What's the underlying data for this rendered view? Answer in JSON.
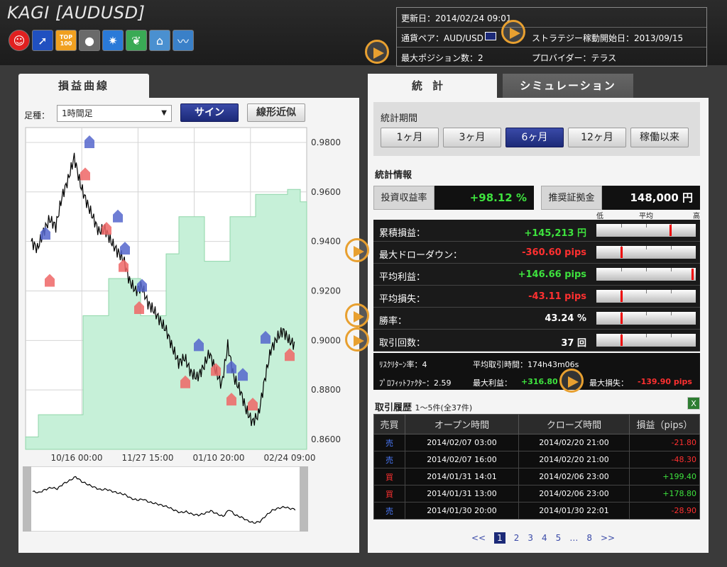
{
  "header": {
    "title": "KAGI [AUDUSD]",
    "icons": [
      "smiley-badge-icon",
      "rising-arrow-badge-icon",
      "top100-badge-icon",
      "sphere-badge-icon",
      "burst-badge-icon",
      "sprout-badge-icon",
      "house-badge-icon",
      "zigzag-chart-badge-icon"
    ],
    "top100_text": "TOP\n100"
  },
  "info": {
    "updated": "更新日：2014/02/24 09:01",
    "pair": "通貨ペア：AUD/USD",
    "start": "ストラテジー稼動開始日：2013/09/15",
    "max_pos": "最大ポジション数：2",
    "provider": "プロバイダー：テラス"
  },
  "left": {
    "tab": "損益曲線",
    "timeframe_label": "足種：",
    "timeframe_value": "1時間足",
    "sign_btn": "サイン",
    "linear_btn": "線形近似"
  },
  "chart_data": {
    "type": "line",
    "y_ticks": [
      "0.9800",
      "0.9600",
      "0.9400",
      "0.9200",
      "0.9000",
      "0.8800",
      "0.8600"
    ],
    "x_ticks": [
      "10/16 00:00",
      "11/27 15:00",
      "01/10 20:00",
      "02/24 09:00"
    ],
    "ylim": [
      0.856,
      0.986
    ],
    "series": [
      {
        "values": [
          0.94,
          0.937,
          0.944,
          0.949,
          0.946,
          0.958,
          0.965,
          0.974,
          0.963,
          0.956,
          0.95,
          0.944,
          0.945,
          0.94,
          0.936,
          0.933,
          0.924,
          0.92,
          0.922,
          0.915,
          0.912,
          0.908,
          0.904,
          0.897,
          0.891,
          0.893,
          0.887,
          0.885,
          0.889,
          0.895,
          0.888,
          0.882,
          0.898,
          0.885,
          0.88,
          0.872,
          0.867,
          0.87,
          0.884,
          0.896,
          0.901,
          0.904,
          0.9,
          0.898
        ]
      }
    ],
    "pl_steps": [
      0.861,
      0.861,
      0.87,
      0.87,
      0.87,
      0.87,
      0.87,
      0.87,
      0.87,
      0.91,
      0.91,
      0.91,
      0.91,
      0.925,
      0.925,
      0.925,
      0.925,
      0.925,
      0.91,
      0.91,
      0.91,
      0.91,
      0.935,
      0.935,
      0.95,
      0.95,
      0.95,
      0.95,
      0.932,
      0.932,
      0.932,
      0.932,
      0.95,
      0.95,
      0.95,
      0.95,
      0.959,
      0.959,
      0.959,
      0.959,
      0.959,
      0.961,
      0.961,
      0.956
    ]
  },
  "right": {
    "tab_stats": "統計",
    "tab_sim": "シミュレーション",
    "period_title": "統計期間",
    "periods": [
      "1ヶ月",
      "3ヶ月",
      "6ヶ月",
      "12ヶ月",
      "稼働以来"
    ],
    "stats_title": "統計情報",
    "roi_label": "投資収益率",
    "roi_value": "+98.12 %",
    "margin_label": "推奨証拠金",
    "margin_value": "148,000 円",
    "scale": {
      "low": "低",
      "mid": "平均",
      "high": "高"
    },
    "rows": [
      {
        "label": "累積損益：",
        "value": "+145,213 円",
        "color": "#3ee23e",
        "level": 0.75
      },
      {
        "label": "最大ドローダウン：",
        "value": "-360.60 pips",
        "color": "#ff3030",
        "level": 0.25
      },
      {
        "label": "平均利益：",
        "value": "+146.66 pips",
        "color": "#3ee23e",
        "level": 0.98
      },
      {
        "label": "平均損失：",
        "value": "-43.11 pips",
        "color": "#ff3030",
        "level": 0.25
      },
      {
        "label": "勝率：",
        "value": "43.24 %",
        "color": "#ffffff",
        "level": 0.25
      },
      {
        "label": "取引回数：",
        "value": "37 回",
        "color": "#ffffff",
        "level": 0.25
      }
    ],
    "extra": {
      "risk_return": "ﾘｽｸﾘﾀｰﾝ率：4",
      "avg_time": "平均取引時間：174h43m06s",
      "profit_factor": "ﾌﾟﾛﾌｨｯﾄﾌｧｸﾀｰ：2.59",
      "max_profit_label": "最大利益：",
      "max_profit_value": "+316.80",
      "max_loss_label": "最大損失：",
      "max_loss_value": "-139.90 pips"
    },
    "history_title": "取引履歴",
    "history_sub": "1～5件(全37件)",
    "history_headers": [
      "売買",
      "オープン時間",
      "クローズ時間",
      "損益（pips）"
    ],
    "history": [
      {
        "side": "売",
        "side_color": "#4a7bff",
        "open": "2014/02/07 03:00",
        "close": "2014/02/20 21:00",
        "pl": "-21.80",
        "pl_color": "#ff3030"
      },
      {
        "side": "売",
        "side_color": "#4a7bff",
        "open": "2014/02/07 16:00",
        "close": "2014/02/20 21:00",
        "pl": "-48.30",
        "pl_color": "#ff3030"
      },
      {
        "side": "買",
        "side_color": "#ff3030",
        "open": "2014/01/31 14:01",
        "close": "2014/02/06 23:00",
        "pl": "+199.40",
        "pl_color": "#3ee23e"
      },
      {
        "side": "買",
        "side_color": "#ff3030",
        "open": "2014/01/31 13:00",
        "close": "2014/02/06 23:00",
        "pl": "+178.80",
        "pl_color": "#3ee23e"
      },
      {
        "side": "売",
        "side_color": "#4a7bff",
        "open": "2014/01/30 20:00",
        "close": "2014/01/30 22:01",
        "pl": "-28.90",
        "pl_color": "#ff3030"
      }
    ],
    "pager": [
      "<<",
      "1",
      "2",
      "3",
      "4",
      "5",
      "…",
      "8",
      ">>"
    ]
  }
}
